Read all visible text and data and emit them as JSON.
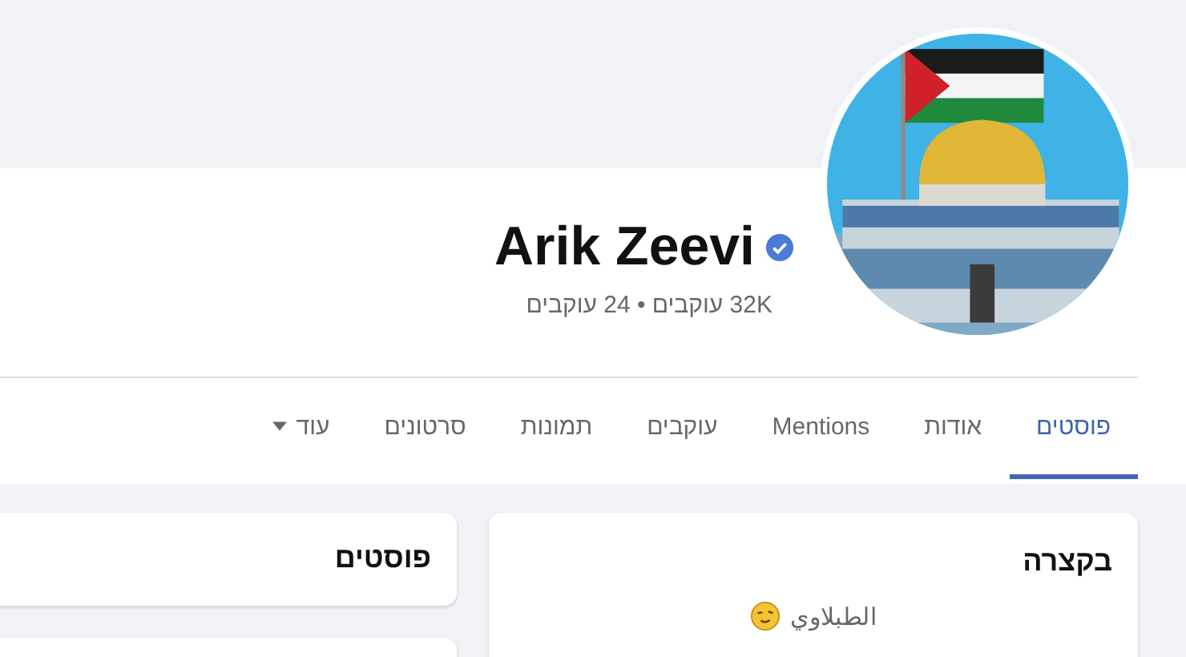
{
  "profile": {
    "name": "Arik Zeevi",
    "verified": true,
    "stats": "32K עוקבים • 24 עוקבים"
  },
  "tabs": [
    {
      "label": "פוסטים",
      "selected": true,
      "kind": "tab"
    },
    {
      "label": "אודות",
      "selected": false,
      "kind": "tab"
    },
    {
      "label": "Mentions",
      "selected": false,
      "kind": "tab"
    },
    {
      "label": "עוקבים",
      "selected": false,
      "kind": "tab"
    },
    {
      "label": "תמונות",
      "selected": false,
      "kind": "tab"
    },
    {
      "label": "סרטונים",
      "selected": false,
      "kind": "tab"
    },
    {
      "label": "עוד",
      "selected": false,
      "kind": "menu"
    }
  ],
  "intro": {
    "title": "בקצרה",
    "bio": "الطبلاوي"
  },
  "posts": {
    "title": "פוסטים"
  }
}
